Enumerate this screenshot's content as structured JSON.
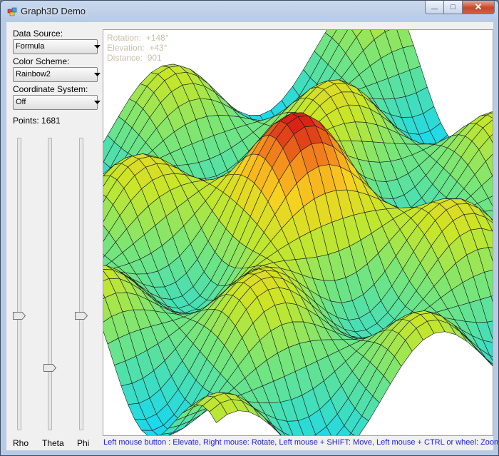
{
  "window": {
    "title": "Graph3D Demo",
    "caption_buttons": {
      "minimize": "—",
      "maximize": "□",
      "close": "✕"
    }
  },
  "controls": {
    "data_source": {
      "label": "Data Source:",
      "value": "Formula"
    },
    "color_scheme": {
      "label": "Color Scheme:",
      "value": "Rainbow2"
    },
    "coordinate_system": {
      "label": "Coordinate System:",
      "value": "Off"
    },
    "points": "Points: 1681"
  },
  "sliders": [
    {
      "label": "Rho",
      "level": 0.61
    },
    {
      "label": "Theta",
      "level": 0.79
    },
    {
      "label": "Phi",
      "level": 0.61
    }
  ],
  "plot": {
    "rotation": "Rotation:  +148°",
    "elevation": "Elevation:  +43°",
    "distance": "Distance:  901",
    "hint": "Left mouse button : Elevate,  Right mouse: Rotate,  Left mouse + SHIFT: Move,  Left mouse + CTRL or wheel: Zoom"
  },
  "colors": {
    "low": "#18d8f0",
    "mid": "#a8e030",
    "high": "#f8d020",
    "peak": "#d81010",
    "hint_text": "#2020d0"
  },
  "icons": {
    "app": "app-icon",
    "dropdown": "dropdown-arrow-icon"
  }
}
